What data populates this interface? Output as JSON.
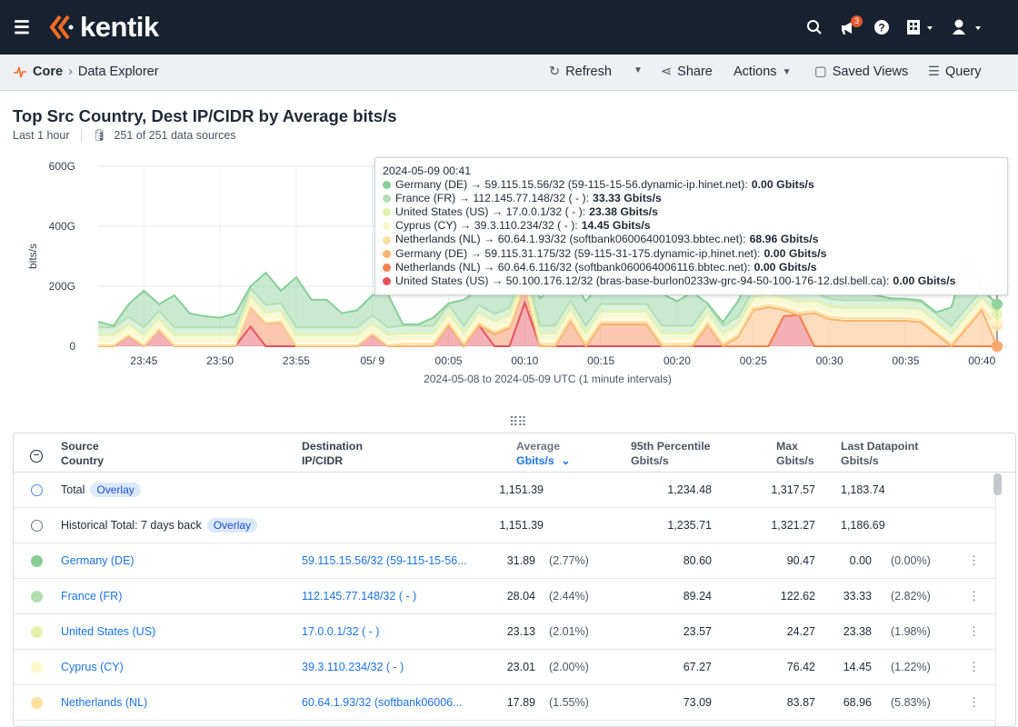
{
  "header": {
    "brand": "kentik",
    "notification_count": "3",
    "icons": [
      "menu-icon",
      "search-icon",
      "megaphone-icon",
      "help-icon",
      "building-icon",
      "user-icon"
    ]
  },
  "subbar": {
    "breadcrumb_root": "Core",
    "breadcrumb_page": "Data Explorer",
    "refresh": "Refresh",
    "share": "Share",
    "actions": "Actions",
    "saved_views": "Saved Views",
    "query": "Query"
  },
  "page": {
    "title": "Top Src Country, Dest IP/CIDR by Average bits/s",
    "time_range": "Last 1 hour",
    "data_sources": "251 of 251 data sources"
  },
  "tooltip": {
    "time": "2024-05-09 00:41",
    "rows": [
      {
        "label": "Germany (DE) → 59.115.15.56/32 (59-115-15-56.dynamic-ip.hinet.net):",
        "value": "0.00 Gbits/s",
        "color": "#86cf95"
      },
      {
        "label": "France (FR) → 112.145.77.148/32 ( - ):",
        "value": "33.33 Gbits/s",
        "color": "#b2e0b1"
      },
      {
        "label": "United States (US) → 17.0.0.1/32 ( - ):",
        "value": "23.38 Gbits/s",
        "color": "#e4f1a9"
      },
      {
        "label": "Cyprus (CY) → 39.3.110.234/32 ( - ):",
        "value": "14.45 Gbits/s",
        "color": "#fdf8c9"
      },
      {
        "label": "Netherlands (NL) → 60.64.1.93/32 (softbank060064001093.bbtec.net):",
        "value": "68.96 Gbits/s",
        "color": "#fde0a0"
      },
      {
        "label": "Germany (DE) → 59.115.31.175/32 (59-115-31-175.dynamic-ip.hinet.net):",
        "value": "0.00 Gbits/s",
        "color": "#fbb36e"
      },
      {
        "label": "Netherlands (NL) → 60.64.6.116/32 (softbank060064006116.bbtec.net):",
        "value": "0.00 Gbits/s",
        "color": "#f6834f"
      },
      {
        "label": "United States (US) → 50.100.176.12/32 (bras-base-burlon0233w-grc-94-50-100-176-12.dsl.bell.ca):",
        "value": "0.00 Gbits/s",
        "color": "#e4535d"
      }
    ]
  },
  "chart_data": {
    "type": "area",
    "stacked": true,
    "ylabel": "bits/s",
    "xlabel": "2024-05-08 to 2024-05-09 UTC (1 minute intervals)",
    "y_ticks": [
      "0",
      "200G",
      "400G",
      "600G"
    ],
    "y_tick_values": [
      0,
      200,
      400,
      600
    ],
    "ylim": [
      0,
      600
    ],
    "y_unit": "Gbits/s",
    "x_range": [
      "23:42",
      "00:41"
    ],
    "x_ticks": [
      {
        "label": "23:45",
        "minute": 3
      },
      {
        "label": "23:50",
        "minute": 8
      },
      {
        "label": "23:55",
        "minute": 13
      },
      {
        "label": "05/ 9",
        "minute": 18
      },
      {
        "label": "00:05",
        "minute": 23
      },
      {
        "label": "00:10",
        "minute": 28
      },
      {
        "label": "00:15",
        "minute": 33
      },
      {
        "label": "00:20",
        "minute": 38
      },
      {
        "label": "00:25",
        "minute": 43
      },
      {
        "label": "00:30",
        "minute": 48
      },
      {
        "label": "00:35",
        "minute": 53
      },
      {
        "label": "00:40",
        "minute": 58
      }
    ],
    "grid": true,
    "series_bottom_to_top": [
      {
        "name": "United States (US) → 50.100.176.12/32",
        "color": "#e4535d",
        "values": [
          0,
          0,
          35,
          0,
          55,
          0,
          0,
          0,
          0,
          0,
          65,
          0,
          0,
          0,
          0,
          0,
          0,
          0,
          40,
          0,
          0,
          0,
          0,
          70,
          0,
          70,
          0,
          0,
          145,
          0,
          0,
          0,
          0,
          0,
          0,
          0,
          0,
          0,
          0,
          0,
          0,
          0,
          0,
          0,
          0,
          100,
          104,
          0,
          0,
          0,
          0,
          0,
          0,
          0,
          0,
          0,
          0,
          0,
          0,
          0
        ]
      },
      {
        "name": "Netherlands (NL) → 60.64.6.116/32",
        "color": "#f6834f",
        "values": [
          0,
          0,
          0,
          0,
          0,
          0,
          0,
          0,
          0,
          0,
          65,
          75,
          80,
          0,
          0,
          0,
          0,
          0,
          0,
          0,
          0,
          0,
          0,
          0,
          0,
          0,
          40,
          60,
          55,
          0,
          0,
          84,
          0,
          73,
          73,
          73,
          73,
          0,
          0,
          0,
          70,
          0,
          0,
          0,
          0,
          0,
          0,
          0,
          0,
          0,
          0,
          0,
          0,
          0,
          0,
          0,
          0,
          0,
          0,
          0
        ]
      },
      {
        "name": "Germany (DE) → 59.115.31.175/32",
        "color": "#fbb36e",
        "values": [
          0,
          0,
          0,
          0,
          0,
          0,
          0,
          0,
          0,
          0,
          0,
          0,
          0,
          0,
          0,
          0,
          0,
          0,
          0,
          0,
          0,
          0,
          0,
          0,
          0,
          0,
          0,
          0,
          0,
          0,
          0,
          0,
          0,
          0,
          0,
          0,
          0,
          0,
          0,
          0,
          0,
          0,
          30,
          120,
          130,
          20,
          0,
          110,
          90,
          85,
          85,
          85,
          85,
          85,
          80,
          40,
          0,
          60,
          120,
          0
        ]
      },
      {
        "name": "Netherlands (NL) → 60.64.1.93/32",
        "color": "#fde0a0",
        "values": [
          3,
          3,
          3,
          3,
          3,
          3,
          3,
          3,
          3,
          3,
          3,
          3,
          3,
          3,
          3,
          3,
          3,
          3,
          3,
          3,
          8,
          8,
          8,
          8,
          8,
          8,
          8,
          8,
          8,
          8,
          8,
          8,
          8,
          8,
          8,
          8,
          8,
          8,
          8,
          8,
          8,
          8,
          8,
          8,
          8,
          8,
          8,
          8,
          8,
          8,
          8,
          8,
          8,
          8,
          8,
          8,
          8,
          8,
          8,
          68.96
        ]
      },
      {
        "name": "Cyprus (CY) → 39.3.110.234/32",
        "color": "#fdf8c9",
        "values": [
          15,
          15,
          15,
          15,
          15,
          15,
          15,
          15,
          15,
          15,
          15,
          15,
          15,
          15,
          15,
          15,
          15,
          15,
          15,
          15,
          15,
          15,
          15,
          15,
          15,
          15,
          15,
          15,
          15,
          15,
          15,
          15,
          15,
          15,
          15,
          15,
          15,
          15,
          15,
          15,
          15,
          15,
          15,
          15,
          15,
          15,
          15,
          15,
          15,
          15,
          15,
          15,
          15,
          15,
          15,
          15,
          15,
          15,
          15,
          14.45
        ]
      },
      {
        "name": "United States (US) → 17.0.0.1/32",
        "color": "#e4f1a9",
        "values": [
          20,
          20,
          20,
          20,
          20,
          20,
          20,
          20,
          20,
          20,
          20,
          20,
          20,
          20,
          20,
          20,
          20,
          20,
          20,
          20,
          20,
          20,
          20,
          20,
          20,
          20,
          20,
          20,
          20,
          20,
          20,
          20,
          20,
          20,
          20,
          20,
          20,
          20,
          20,
          20,
          20,
          20,
          20,
          20,
          20,
          20,
          20,
          20,
          20,
          20,
          20,
          20,
          20,
          20,
          20,
          20,
          20,
          20,
          20,
          23.38
        ]
      },
      {
        "name": "France (FR) → 112.145.77.148/32",
        "color": "#b2e0b1",
        "values": [
          25,
          25,
          25,
          25,
          25,
          25,
          25,
          25,
          25,
          25,
          25,
          25,
          25,
          25,
          25,
          25,
          25,
          25,
          25,
          25,
          25,
          25,
          25,
          25,
          25,
          25,
          25,
          25,
          25,
          25,
          25,
          25,
          25,
          25,
          25,
          25,
          25,
          25,
          25,
          25,
          25,
          25,
          25,
          25,
          25,
          25,
          25,
          25,
          25,
          25,
          25,
          25,
          25,
          25,
          25,
          25,
          25,
          25,
          25,
          33.33
        ]
      },
      {
        "name": "Germany (DE) → 59.115.15.56/32",
        "color": "#86cf95",
        "values": [
          19,
          5,
          42,
          122,
          22,
          107,
          47,
          37,
          32,
          47,
          7,
          107,
          42,
          167,
          92,
          92,
          47,
          57,
          67,
          112,
          5,
          5,
          27,
          5,
          87,
          52,
          102,
          102,
          5,
          92,
          132,
          78,
          82,
          69,
          79,
          59,
          54,
          107,
          82,
          112,
          5,
          12,
          52,
          72,
          52,
          12,
          8,
          12,
          62,
          47,
          27,
          17,
          7,
          5,
          5,
          5,
          62,
          172,
          5,
          0
        ]
      }
    ]
  },
  "table": {
    "headers": {
      "source": "Source",
      "source2": "Country",
      "dest": "Destination",
      "dest2": "IP/CIDR",
      "avg": "Average",
      "avg_unit": "Gbits/s",
      "p95": "95th Percentile",
      "p95_unit": "Gbits/s",
      "max": "Max",
      "max_unit": "Gbits/s",
      "last": "Last Datapoint",
      "last_unit": "Gbits/s"
    },
    "overlay_label": "Overlay",
    "totals": [
      {
        "label": "Total",
        "avg": "1,151.39",
        "p95": "1,234.48",
        "max": "1,317.57",
        "last": "1,183.74"
      },
      {
        "label": "Historical Total: 7 days back",
        "avg": "1,151.39",
        "p95": "1,235.71",
        "max": "1,321.27",
        "last": "1,186.69"
      }
    ],
    "rows": [
      {
        "country": "Germany (DE)",
        "dest": "59.115.15.56/32 (59-115-15-56...",
        "avg": "31.89",
        "avg_pct": "(2.77%)",
        "p95": "80.60",
        "max": "90.47",
        "last": "0.00",
        "last_pct": "(0.00%)",
        "color": "#86cf95"
      },
      {
        "country": "France (FR)",
        "dest": "112.145.77.148/32 ( - )",
        "avg": "28.04",
        "avg_pct": "(2.44%)",
        "p95": "89.24",
        "max": "122.62",
        "last": "33.33",
        "last_pct": "(2.82%)",
        "color": "#b2e0b1"
      },
      {
        "country": "United States (US)",
        "dest": "17.0.0.1/32 ( - )",
        "avg": "23.13",
        "avg_pct": "(2.01%)",
        "p95": "23.57",
        "max": "24.27",
        "last": "23.38",
        "last_pct": "(1.98%)",
        "color": "#e4f1a9"
      },
      {
        "country": "Cyprus (CY)",
        "dest": "39.3.110.234/32 ( - )",
        "avg": "23.01",
        "avg_pct": "(2.00%)",
        "p95": "67.27",
        "max": "76.42",
        "last": "14.45",
        "last_pct": "(1.22%)",
        "color": "#fdf8c9"
      },
      {
        "country": "Netherlands (NL)",
        "dest": "60.64.1.93/32 (softbank06006...",
        "avg": "17.89",
        "avg_pct": "(1.55%)",
        "p95": "73.09",
        "max": "83.87",
        "last": "68.96",
        "last_pct": "(5.83%)",
        "color": "#fde0a0"
      }
    ]
  }
}
